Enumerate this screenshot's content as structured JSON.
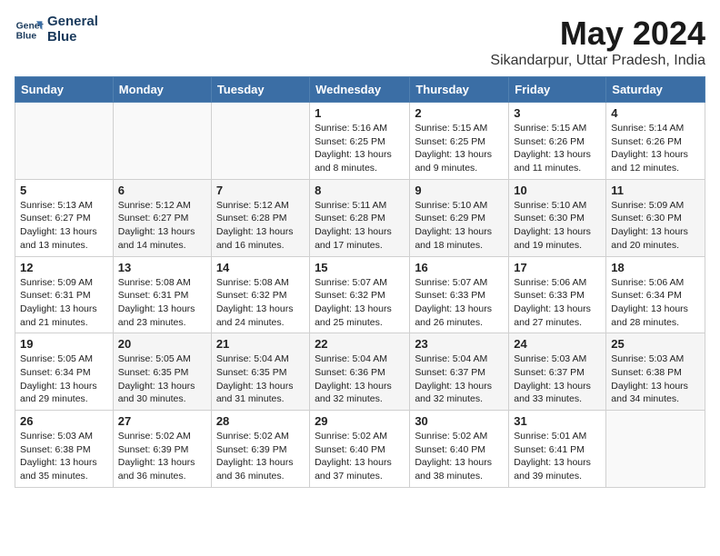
{
  "logo": {
    "line1": "General",
    "line2": "Blue"
  },
  "title": "May 2024",
  "subtitle": "Sikandarpur, Uttar Pradesh, India",
  "days_of_week": [
    "Sunday",
    "Monday",
    "Tuesday",
    "Wednesday",
    "Thursday",
    "Friday",
    "Saturday"
  ],
  "weeks": [
    [
      {
        "day": "",
        "info": ""
      },
      {
        "day": "",
        "info": ""
      },
      {
        "day": "",
        "info": ""
      },
      {
        "day": "1",
        "info": "Sunrise: 5:16 AM\nSunset: 6:25 PM\nDaylight: 13 hours\nand 8 minutes."
      },
      {
        "day": "2",
        "info": "Sunrise: 5:15 AM\nSunset: 6:25 PM\nDaylight: 13 hours\nand 9 minutes."
      },
      {
        "day": "3",
        "info": "Sunrise: 5:15 AM\nSunset: 6:26 PM\nDaylight: 13 hours\nand 11 minutes."
      },
      {
        "day": "4",
        "info": "Sunrise: 5:14 AM\nSunset: 6:26 PM\nDaylight: 13 hours\nand 12 minutes."
      }
    ],
    [
      {
        "day": "5",
        "info": "Sunrise: 5:13 AM\nSunset: 6:27 PM\nDaylight: 13 hours\nand 13 minutes."
      },
      {
        "day": "6",
        "info": "Sunrise: 5:12 AM\nSunset: 6:27 PM\nDaylight: 13 hours\nand 14 minutes."
      },
      {
        "day": "7",
        "info": "Sunrise: 5:12 AM\nSunset: 6:28 PM\nDaylight: 13 hours\nand 16 minutes."
      },
      {
        "day": "8",
        "info": "Sunrise: 5:11 AM\nSunset: 6:28 PM\nDaylight: 13 hours\nand 17 minutes."
      },
      {
        "day": "9",
        "info": "Sunrise: 5:10 AM\nSunset: 6:29 PM\nDaylight: 13 hours\nand 18 minutes."
      },
      {
        "day": "10",
        "info": "Sunrise: 5:10 AM\nSunset: 6:30 PM\nDaylight: 13 hours\nand 19 minutes."
      },
      {
        "day": "11",
        "info": "Sunrise: 5:09 AM\nSunset: 6:30 PM\nDaylight: 13 hours\nand 20 minutes."
      }
    ],
    [
      {
        "day": "12",
        "info": "Sunrise: 5:09 AM\nSunset: 6:31 PM\nDaylight: 13 hours\nand 21 minutes."
      },
      {
        "day": "13",
        "info": "Sunrise: 5:08 AM\nSunset: 6:31 PM\nDaylight: 13 hours\nand 23 minutes."
      },
      {
        "day": "14",
        "info": "Sunrise: 5:08 AM\nSunset: 6:32 PM\nDaylight: 13 hours\nand 24 minutes."
      },
      {
        "day": "15",
        "info": "Sunrise: 5:07 AM\nSunset: 6:32 PM\nDaylight: 13 hours\nand 25 minutes."
      },
      {
        "day": "16",
        "info": "Sunrise: 5:07 AM\nSunset: 6:33 PM\nDaylight: 13 hours\nand 26 minutes."
      },
      {
        "day": "17",
        "info": "Sunrise: 5:06 AM\nSunset: 6:33 PM\nDaylight: 13 hours\nand 27 minutes."
      },
      {
        "day": "18",
        "info": "Sunrise: 5:06 AM\nSunset: 6:34 PM\nDaylight: 13 hours\nand 28 minutes."
      }
    ],
    [
      {
        "day": "19",
        "info": "Sunrise: 5:05 AM\nSunset: 6:34 PM\nDaylight: 13 hours\nand 29 minutes."
      },
      {
        "day": "20",
        "info": "Sunrise: 5:05 AM\nSunset: 6:35 PM\nDaylight: 13 hours\nand 30 minutes."
      },
      {
        "day": "21",
        "info": "Sunrise: 5:04 AM\nSunset: 6:35 PM\nDaylight: 13 hours\nand 31 minutes."
      },
      {
        "day": "22",
        "info": "Sunrise: 5:04 AM\nSunset: 6:36 PM\nDaylight: 13 hours\nand 32 minutes."
      },
      {
        "day": "23",
        "info": "Sunrise: 5:04 AM\nSunset: 6:37 PM\nDaylight: 13 hours\nand 32 minutes."
      },
      {
        "day": "24",
        "info": "Sunrise: 5:03 AM\nSunset: 6:37 PM\nDaylight: 13 hours\nand 33 minutes."
      },
      {
        "day": "25",
        "info": "Sunrise: 5:03 AM\nSunset: 6:38 PM\nDaylight: 13 hours\nand 34 minutes."
      }
    ],
    [
      {
        "day": "26",
        "info": "Sunrise: 5:03 AM\nSunset: 6:38 PM\nDaylight: 13 hours\nand 35 minutes."
      },
      {
        "day": "27",
        "info": "Sunrise: 5:02 AM\nSunset: 6:39 PM\nDaylight: 13 hours\nand 36 minutes."
      },
      {
        "day": "28",
        "info": "Sunrise: 5:02 AM\nSunset: 6:39 PM\nDaylight: 13 hours\nand 36 minutes."
      },
      {
        "day": "29",
        "info": "Sunrise: 5:02 AM\nSunset: 6:40 PM\nDaylight: 13 hours\nand 37 minutes."
      },
      {
        "day": "30",
        "info": "Sunrise: 5:02 AM\nSunset: 6:40 PM\nDaylight: 13 hours\nand 38 minutes."
      },
      {
        "day": "31",
        "info": "Sunrise: 5:01 AM\nSunset: 6:41 PM\nDaylight: 13 hours\nand 39 minutes."
      },
      {
        "day": "",
        "info": ""
      }
    ]
  ]
}
